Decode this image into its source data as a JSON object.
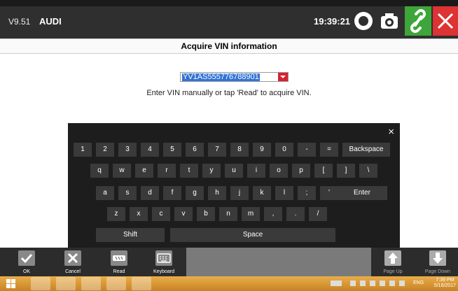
{
  "header": {
    "version": "V9.51",
    "make": "AUDI",
    "time": "19:39:21",
    "icons": [
      "record-icon",
      "camera-icon",
      "link-icon",
      "close-icon"
    ]
  },
  "page_title": "Acquire VIN information",
  "vin_field": {
    "value": "YV1AS555776788901"
  },
  "instruction": "Enter VIN manually or tap 'Read' to acquire VIN.",
  "keyboard": {
    "close": "×",
    "row1": [
      "1",
      "2",
      "3",
      "4",
      "5",
      "6",
      "7",
      "8",
      "9",
      "0",
      "-",
      "=",
      "Backspace"
    ],
    "row2": [
      "q",
      "w",
      "e",
      "r",
      "t",
      "y",
      "u",
      "i",
      "o",
      "p",
      "[",
      "]",
      "\\"
    ],
    "row3": [
      "a",
      "s",
      "d",
      "f",
      "g",
      "h",
      "j",
      "k",
      "l",
      ";",
      "'",
      "Enter"
    ],
    "row4": [
      "z",
      "x",
      "c",
      "v",
      "b",
      "n",
      "m",
      ",",
      ".",
      "/"
    ],
    "row5": [
      "Shift",
      "Space"
    ]
  },
  "toolbar": {
    "ok": "OK",
    "cancel": "Cancel",
    "read": "Read",
    "keyboard": "Keyboard",
    "page_up": "Page Up",
    "page_down": "Page Down"
  },
  "taskbar": {
    "lang": "ENG",
    "time": "7:39 PM",
    "date": "5/16/2017"
  }
}
